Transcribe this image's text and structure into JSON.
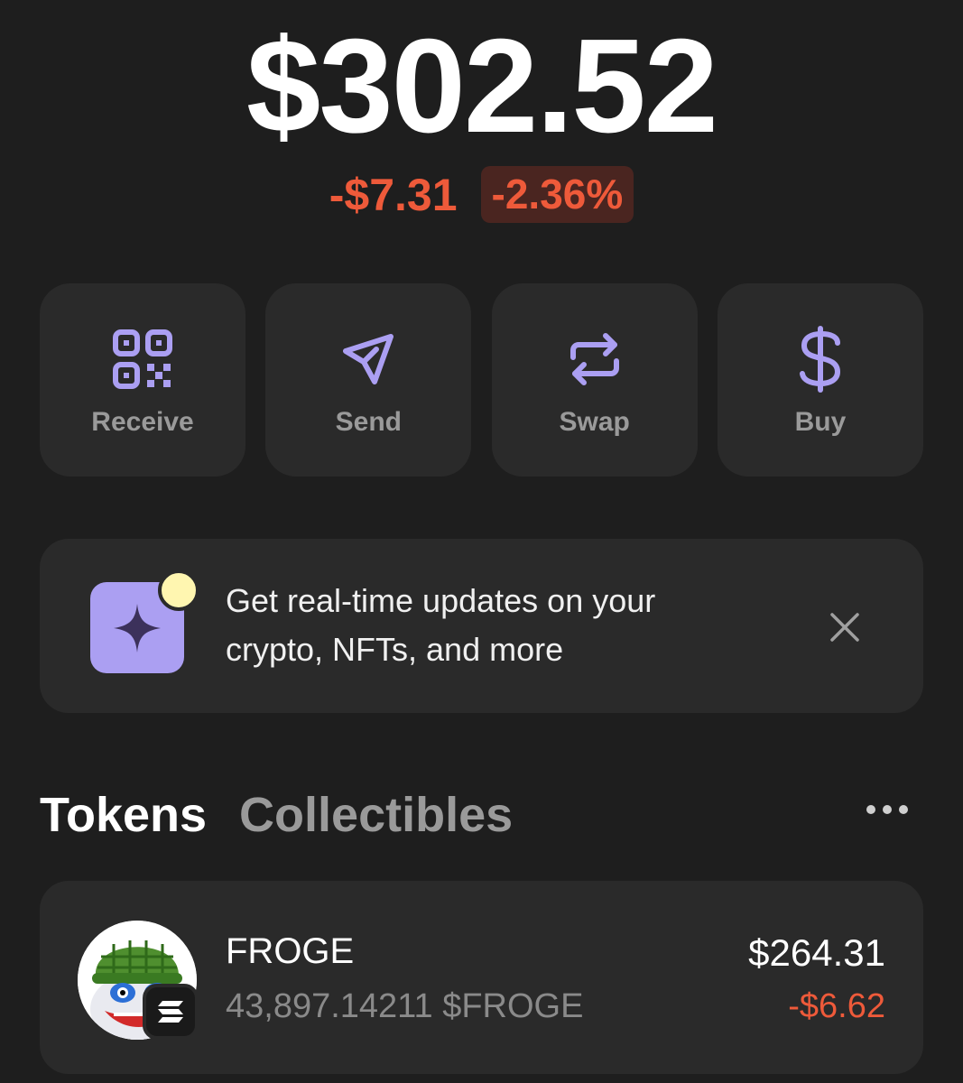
{
  "balance": {
    "total": "$302.52",
    "change_amount": "-$7.31",
    "change_percent": "-2.36%"
  },
  "actions": [
    {
      "label": "Receive",
      "icon": "qr-code-icon"
    },
    {
      "label": "Send",
      "icon": "send-icon"
    },
    {
      "label": "Swap",
      "icon": "swap-icon"
    },
    {
      "label": "Buy",
      "icon": "dollar-icon"
    }
  ],
  "banner": {
    "text_line1": "Get real-time updates on your",
    "text_line2": "crypto, NFTs, and more",
    "icon": "sparkle-icon",
    "close_icon": "close-icon"
  },
  "tabs": {
    "tokens": "Tokens",
    "collectibles": "Collectibles",
    "more_icon": "more-icon"
  },
  "tokens": [
    {
      "name": "FROGE",
      "quantity": "43,897.14211 $FROGE",
      "value": "$264.31",
      "change": "-$6.62",
      "chain_icon": "solana-icon"
    }
  ],
  "colors": {
    "background": "#1e1e1e",
    "card": "#2a2a2a",
    "accent": "#ab9ff2",
    "negative": "#ee5a3a"
  }
}
